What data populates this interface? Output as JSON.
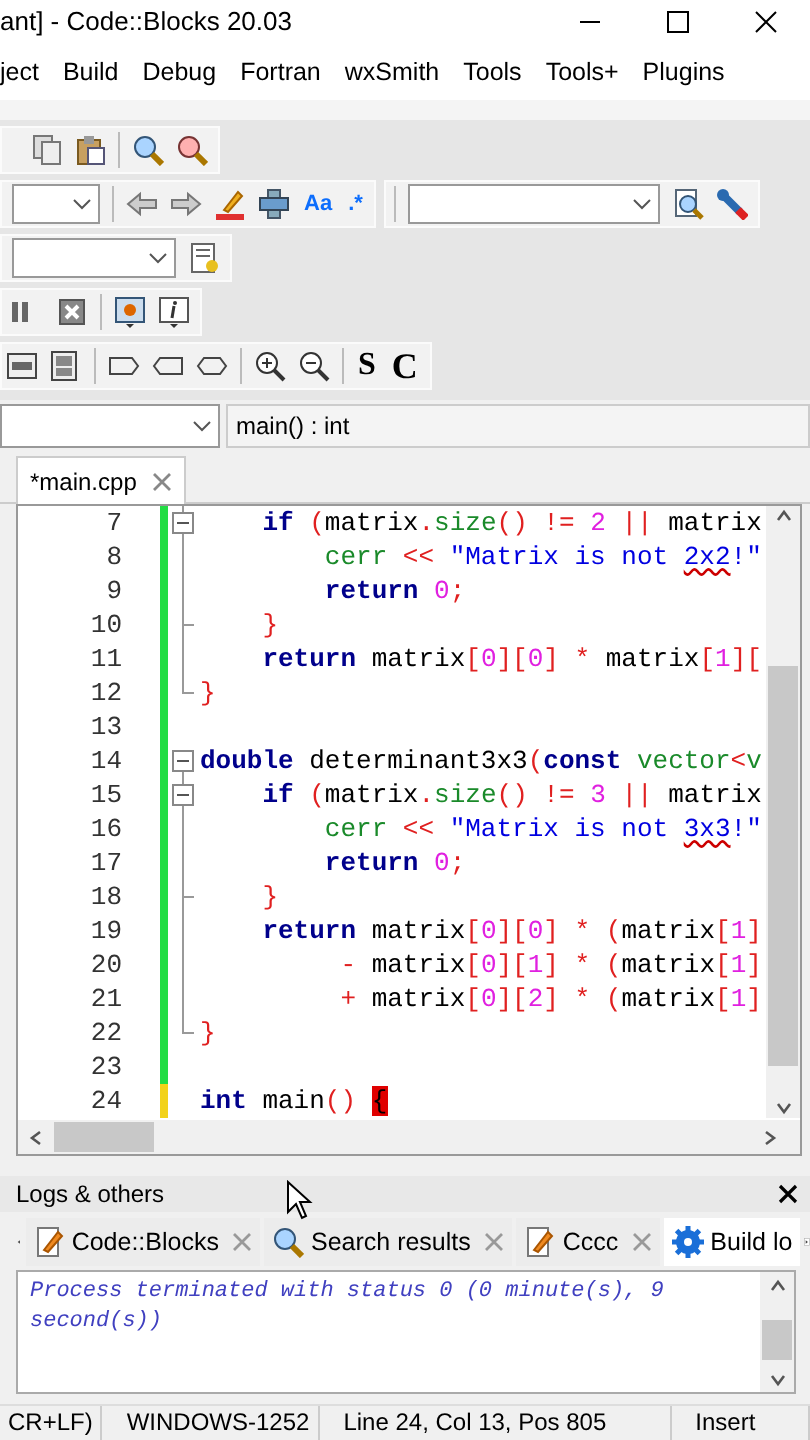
{
  "window": {
    "title": "ant] - Code::Blocks 20.03"
  },
  "menu": [
    "ject",
    "Build",
    "Debug",
    "Fortran",
    "wxSmith",
    "Tools",
    "Tools+",
    "Plugins"
  ],
  "toolbar_glyphs": [
    "Aa",
    ".*",
    "S",
    "C"
  ],
  "function_bar": {
    "scope": "main() : int"
  },
  "editor_tabs": [
    {
      "label": "*main.cpp",
      "selected": true
    }
  ],
  "code": [
    {
      "number": "7",
      "saved": true,
      "fold_start": true,
      "fold_end": false,
      "tokens": [
        {
          "kind": "keyword",
          "text": "    if"
        },
        {
          "kind": "operator",
          "text": " ("
        },
        {
          "kind": "plain",
          "text": "matrix"
        },
        {
          "kind": "operator",
          "text": "."
        },
        {
          "kind": "function",
          "text": "size"
        },
        {
          "kind": "operator",
          "text": "() !="
        },
        {
          "kind": "number",
          "text": " 2"
        },
        {
          "kind": "operator",
          "text": " ||"
        },
        {
          "kind": "plain",
          "text": " matrix"
        }
      ]
    },
    {
      "number": "8",
      "saved": true,
      "fold_start": false,
      "fold_end": false,
      "tokens": [
        {
          "kind": "function",
          "text": "        cerr"
        },
        {
          "kind": "operator",
          "text": " <<"
        },
        {
          "kind": "string",
          "text": " \"Matrix is not "
        },
        {
          "kind": "misspelled",
          "text": "2x2"
        },
        {
          "kind": "string",
          "text": "!\""
        }
      ]
    },
    {
      "number": "9",
      "saved": true,
      "fold_start": false,
      "fold_end": false,
      "tokens": [
        {
          "kind": "keyword",
          "text": "        return"
        },
        {
          "kind": "number",
          "text": " 0"
        },
        {
          "kind": "operator",
          "text": ";"
        }
      ]
    },
    {
      "number": "10",
      "saved": true,
      "fold_start": false,
      "fold_end": true,
      "tokens": [
        {
          "kind": "operator",
          "text": "    }"
        }
      ]
    },
    {
      "number": "11",
      "saved": true,
      "fold_start": false,
      "fold_end": false,
      "tokens": [
        {
          "kind": "keyword",
          "text": "    return"
        },
        {
          "kind": "plain",
          "text": " matrix"
        },
        {
          "kind": "operator",
          "text": "["
        },
        {
          "kind": "number",
          "text": "0"
        },
        {
          "kind": "operator",
          "text": "]["
        },
        {
          "kind": "number",
          "text": "0"
        },
        {
          "kind": "operator",
          "text": "] *"
        },
        {
          "kind": "plain",
          "text": " matrix"
        },
        {
          "kind": "operator",
          "text": "["
        },
        {
          "kind": "number",
          "text": "1"
        },
        {
          "kind": "operator",
          "text": "]["
        }
      ]
    },
    {
      "number": "12",
      "saved": true,
      "fold_start": false,
      "fold_end": true,
      "tokens": [
        {
          "kind": "operator",
          "text": "}"
        }
      ]
    },
    {
      "number": "13",
      "saved": true,
      "fold_start": false,
      "fold_end": false
    },
    {
      "number": "14",
      "saved": true,
      "fold_start": true,
      "fold_end": false,
      "tokens": [
        {
          "kind": "keyword",
          "text": "double"
        },
        {
          "kind": "plain",
          "text": " determinant3x3"
        },
        {
          "kind": "operator",
          "text": "("
        },
        {
          "kind": "keyword",
          "text": "const"
        },
        {
          "kind": "function",
          "text": " vector"
        },
        {
          "kind": "operator",
          "text": "<"
        },
        {
          "kind": "function",
          "text": "v"
        }
      ]
    },
    {
      "number": "15",
      "saved": true,
      "fold_start": true,
      "fold_end": false,
      "tokens": [
        {
          "kind": "keyword",
          "text": "    if"
        },
        {
          "kind": "operator",
          "text": " ("
        },
        {
          "kind": "plain",
          "text": "matrix"
        },
        {
          "kind": "operator",
          "text": "."
        },
        {
          "kind": "function",
          "text": "size"
        },
        {
          "kind": "operator",
          "text": "() !="
        },
        {
          "kind": "number",
          "text": " 3"
        },
        {
          "kind": "operator",
          "text": " ||"
        },
        {
          "kind": "plain",
          "text": " matrix"
        }
      ]
    },
    {
      "number": "16",
      "saved": true,
      "fold_start": false,
      "fold_end": false,
      "tokens": [
        {
          "kind": "function",
          "text": "        cerr"
        },
        {
          "kind": "operator",
          "text": " <<"
        },
        {
          "kind": "string",
          "text": " \"Matrix is not "
        },
        {
          "kind": "misspelled",
          "text": "3x3"
        },
        {
          "kind": "string",
          "text": "!\""
        }
      ]
    },
    {
      "number": "17",
      "saved": true,
      "fold_start": false,
      "fold_end": false,
      "tokens": [
        {
          "kind": "keyword",
          "text": "        return"
        },
        {
          "kind": "number",
          "text": " 0"
        },
        {
          "kind": "operator",
          "text": ";"
        }
      ]
    },
    {
      "number": "18",
      "saved": true,
      "fold_start": false,
      "fold_end": true,
      "tokens": [
        {
          "kind": "operator",
          "text": "    }"
        }
      ]
    },
    {
      "number": "19",
      "saved": true,
      "fold_start": false,
      "fold_end": false,
      "tokens": [
        {
          "kind": "keyword",
          "text": "    return"
        },
        {
          "kind": "plain",
          "text": " matrix"
        },
        {
          "kind": "operator",
          "text": "["
        },
        {
          "kind": "number",
          "text": "0"
        },
        {
          "kind": "operator",
          "text": "]["
        },
        {
          "kind": "number",
          "text": "0"
        },
        {
          "kind": "operator",
          "text": "] * ("
        },
        {
          "kind": "plain",
          "text": "matrix"
        },
        {
          "kind": "operator",
          "text": "["
        },
        {
          "kind": "number",
          "text": "1"
        },
        {
          "kind": "operator",
          "text": "]"
        }
      ]
    },
    {
      "number": "20",
      "saved": true,
      "fold_start": false,
      "fold_end": false,
      "tokens": [
        {
          "kind": "operator",
          "text": "         -"
        },
        {
          "kind": "plain",
          "text": " matrix"
        },
        {
          "kind": "operator",
          "text": "["
        },
        {
          "kind": "number",
          "text": "0"
        },
        {
          "kind": "operator",
          "text": "]["
        },
        {
          "kind": "number",
          "text": "1"
        },
        {
          "kind": "operator",
          "text": "] * ("
        },
        {
          "kind": "plain",
          "text": "matrix"
        },
        {
          "kind": "operator",
          "text": "["
        },
        {
          "kind": "number",
          "text": "1"
        },
        {
          "kind": "operator",
          "text": "]"
        }
      ]
    },
    {
      "number": "21",
      "saved": true,
      "fold_start": false,
      "fold_end": false,
      "tokens": [
        {
          "kind": "operator",
          "text": "         +"
        },
        {
          "kind": "plain",
          "text": " matrix"
        },
        {
          "kind": "operator",
          "text": "["
        },
        {
          "kind": "number",
          "text": "0"
        },
        {
          "kind": "operator",
          "text": "]["
        },
        {
          "kind": "number",
          "text": "2"
        },
        {
          "kind": "operator",
          "text": "] * ("
        },
        {
          "kind": "plain",
          "text": "matrix"
        },
        {
          "kind": "operator",
          "text": "["
        },
        {
          "kind": "number",
          "text": "1"
        },
        {
          "kind": "operator",
          "text": "]"
        }
      ]
    },
    {
      "number": "22",
      "saved": true,
      "fold_start": false,
      "fold_end": true,
      "tokens": [
        {
          "kind": "operator",
          "text": "}"
        }
      ]
    },
    {
      "number": "23",
      "saved": true,
      "fold_start": false,
      "fold_end": false
    },
    {
      "number": "24",
      "saved": false,
      "fold_start": false,
      "fold_end": false,
      "tokens": [
        {
          "kind": "keyword",
          "text": "int"
        },
        {
          "kind": "plain",
          "text": " main"
        },
        {
          "kind": "operator",
          "text": "() "
        },
        {
          "kind": "brace-error",
          "text": "{"
        }
      ]
    }
  ],
  "logs": {
    "title": "Logs & others",
    "tabs": [
      {
        "label": "Code::Blocks",
        "kind": "log",
        "selected": false
      },
      {
        "label": "Search results",
        "kind": "search",
        "selected": false
      },
      {
        "label": "Cccc",
        "kind": "log",
        "selected": false
      },
      {
        "label": "Build lo",
        "kind": "build",
        "selected": true
      }
    ],
    "text": "Process terminated with status 0 (0 minute(s), 9 second(s))"
  },
  "status_bar": [
    "CR+LF)",
    "WINDOWS-1252",
    "Line 24, Col 13, Pos 805",
    "Insert"
  ]
}
